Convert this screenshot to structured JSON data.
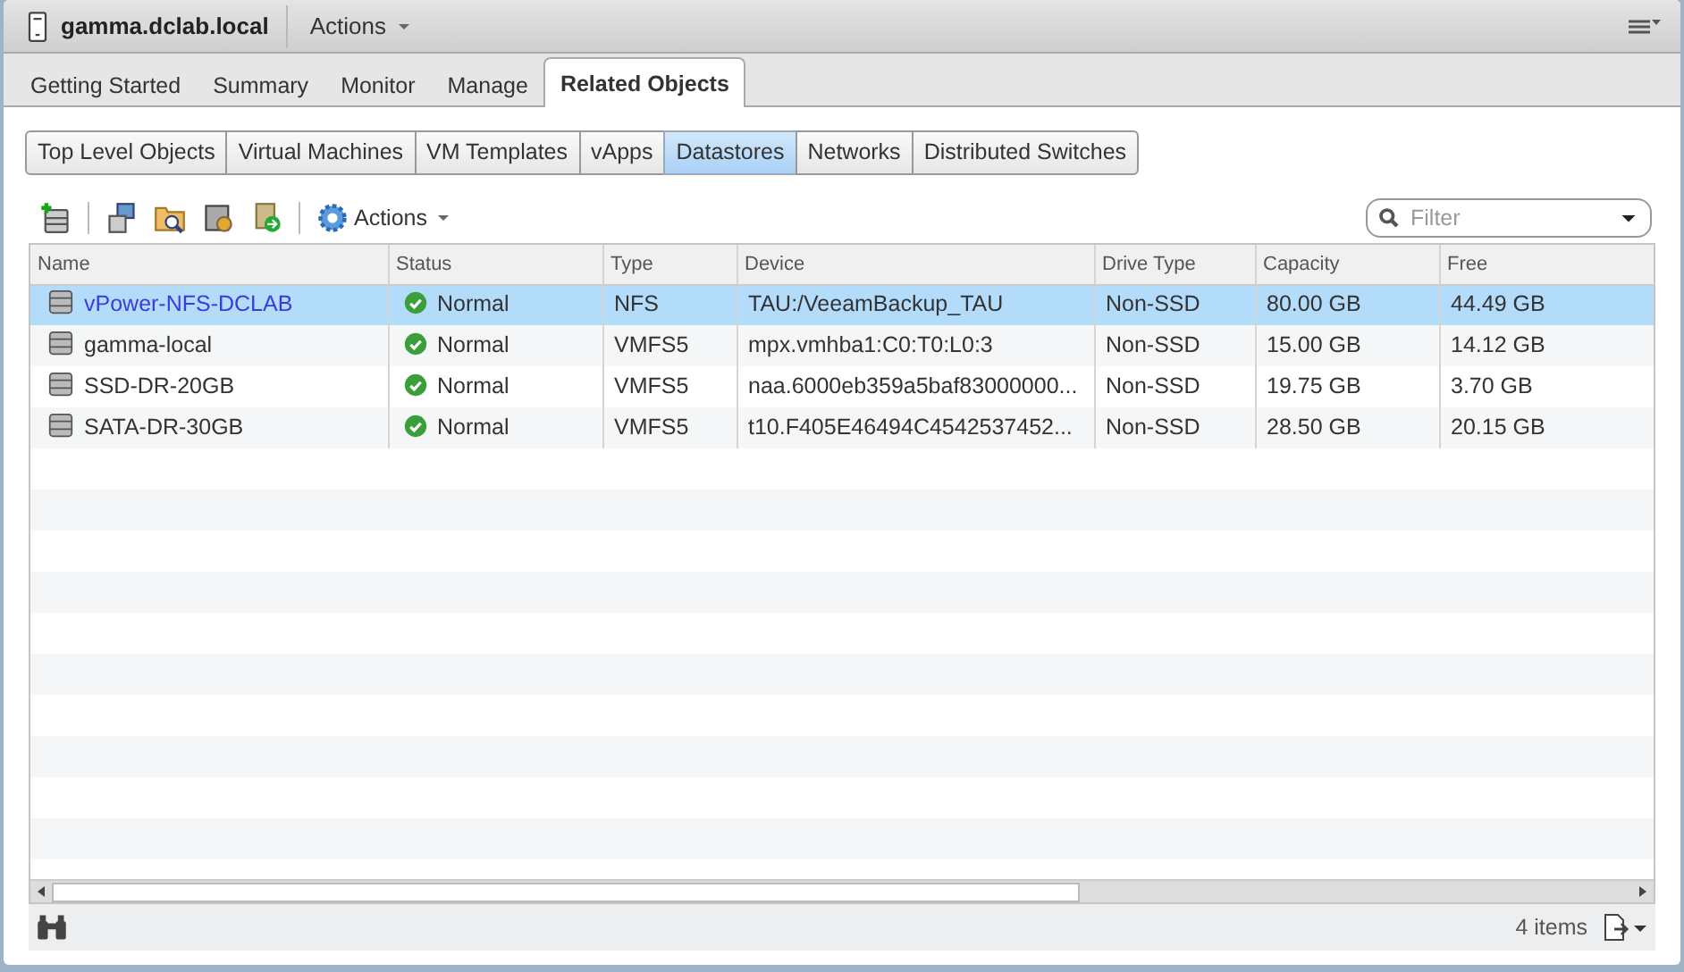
{
  "header": {
    "title": "gamma.dclab.local",
    "actions": "Actions"
  },
  "tabs": [
    {
      "label": "Getting Started",
      "selected": false
    },
    {
      "label": "Summary",
      "selected": false
    },
    {
      "label": "Monitor",
      "selected": false
    },
    {
      "label": "Manage",
      "selected": false
    },
    {
      "label": "Related Objects",
      "selected": true
    }
  ],
  "subtabs": [
    {
      "label": "Top Level Objects",
      "selected": false
    },
    {
      "label": "Virtual Machines",
      "selected": false
    },
    {
      "label": "VM Templates",
      "selected": false
    },
    {
      "label": "vApps",
      "selected": false
    },
    {
      "label": "Datastores",
      "selected": true
    },
    {
      "label": "Networks",
      "selected": false
    },
    {
      "label": "Distributed Switches",
      "selected": false
    }
  ],
  "toolbar": {
    "actions": "Actions",
    "filter": {
      "placeholder": "Filter"
    }
  },
  "table": {
    "columns": [
      "Name",
      "Status",
      "Type",
      "Device",
      "Drive Type",
      "Capacity",
      "Free"
    ],
    "rows": [
      {
        "selected": true,
        "cells": [
          "vPower-NFS-DCLAB",
          "Normal",
          "NFS",
          "TAU:/VeeamBackup_TAU",
          "Non-SSD",
          "80.00 GB",
          "44.49 GB"
        ]
      },
      {
        "selected": false,
        "cells": [
          "gamma-local",
          "Normal",
          "VMFS5",
          "mpx.vmhba1:C0:T0:L0:3",
          "Non-SSD",
          "15.00 GB",
          "14.12 GB"
        ]
      },
      {
        "selected": false,
        "cells": [
          "SSD-DR-20GB",
          "Normal",
          "VMFS5",
          "naa.6000eb359a5baf83000000...",
          "Non-SSD",
          "19.75 GB",
          "3.70 GB"
        ]
      },
      {
        "selected": false,
        "cells": [
          "SATA-DR-30GB",
          "Normal",
          "VMFS5",
          "t10.F405E46494C4542537452...",
          "Non-SSD",
          "28.50 GB",
          "20.15 GB"
        ]
      }
    ]
  },
  "footer": {
    "count": "4 items"
  }
}
